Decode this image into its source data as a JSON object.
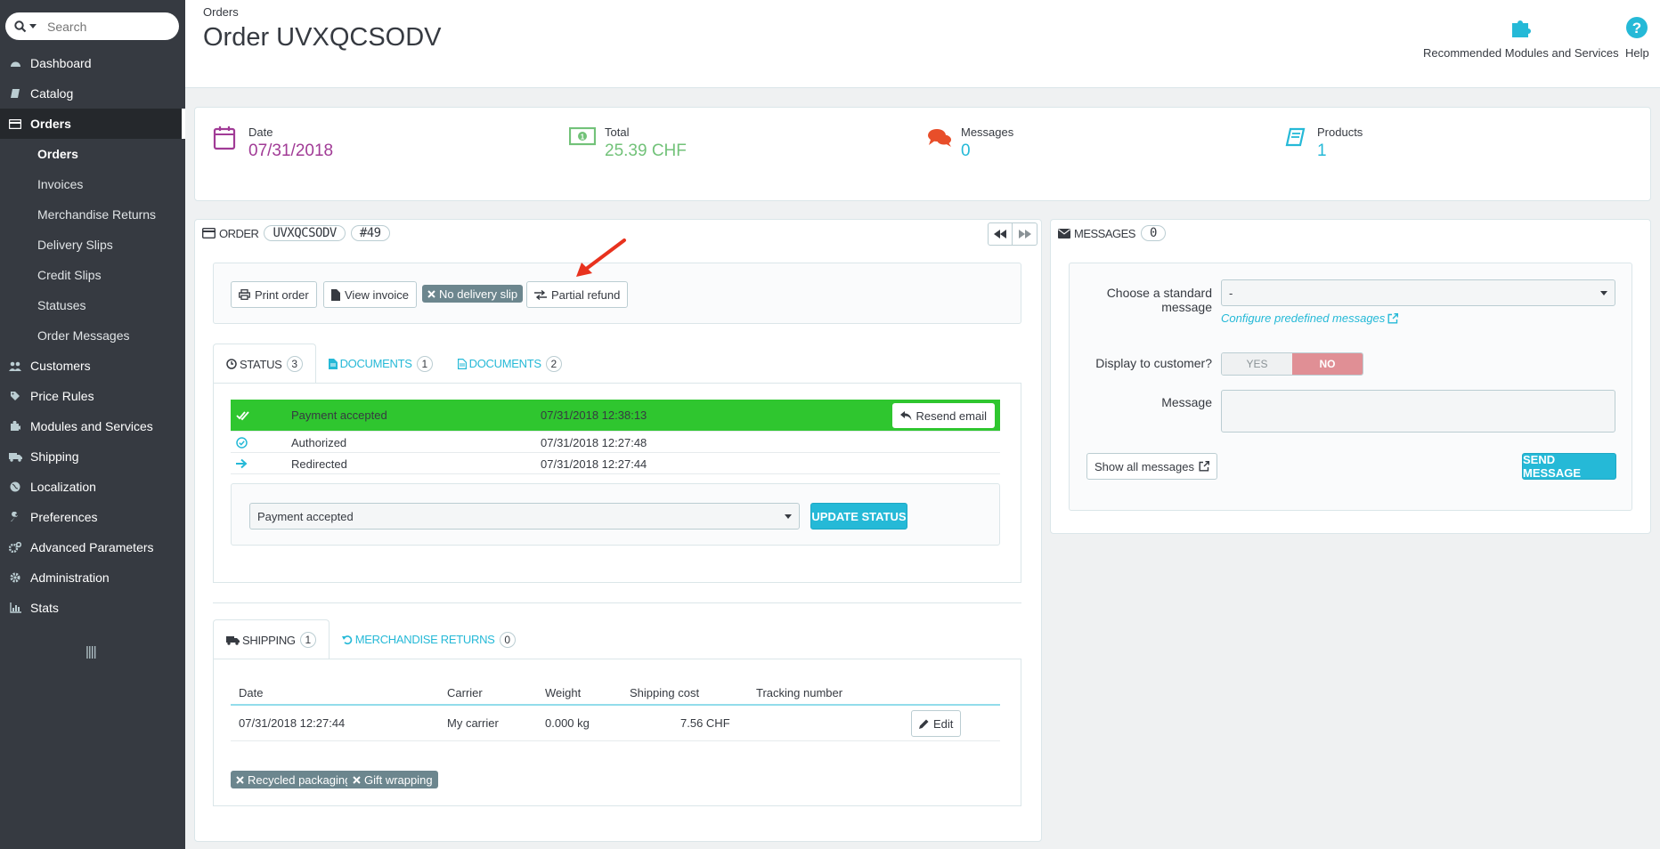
{
  "search": {
    "placeholder": "Search"
  },
  "menu": [
    {
      "name": "dashboard",
      "label": "Dashboard",
      "icon": "dashboard-icon"
    },
    {
      "name": "catalog",
      "label": "Catalog",
      "icon": "catalog-icon"
    },
    {
      "name": "orders",
      "label": "Orders",
      "icon": "orders-icon"
    },
    {
      "name": "customers",
      "label": "Customers",
      "icon": "customers-icon"
    },
    {
      "name": "price-rules",
      "label": "Price Rules",
      "icon": "tag-icon"
    },
    {
      "name": "modules",
      "label": "Modules and Services",
      "icon": "puzzle-icon"
    },
    {
      "name": "shipping",
      "label": "Shipping",
      "icon": "truck-icon"
    },
    {
      "name": "localization",
      "label": "Localization",
      "icon": "globe-icon"
    },
    {
      "name": "preferences",
      "label": "Preferences",
      "icon": "wrench-icon"
    },
    {
      "name": "advanced",
      "label": "Advanced Parameters",
      "icon": "cogs-icon"
    },
    {
      "name": "administration",
      "label": "Administration",
      "icon": "gear-icon"
    },
    {
      "name": "stats",
      "label": "Stats",
      "icon": "bar-chart-icon"
    }
  ],
  "submenu": [
    "Orders",
    "Invoices",
    "Merchandise Returns",
    "Delivery Slips",
    "Credit Slips",
    "Statuses",
    "Order Messages"
  ],
  "header": {
    "breadcrumb": "Orders",
    "title": "Order UVXQCSODV",
    "modules_label": "Recommended Modules and Services",
    "help_label": "Help"
  },
  "kpis": {
    "date_label": "Date",
    "date_value": "07/31/2018",
    "total_label": "Total",
    "total_value": "25.39 CHF",
    "messages_label": "Messages",
    "messages_value": "0",
    "products_label": "Products",
    "products_value": "1"
  },
  "order_panel": {
    "heading": "ORDER",
    "reference": "UVXQCSODV",
    "number": "#49",
    "print_label": "Print order",
    "invoice_label": "View invoice",
    "no_delivery_label": "No delivery slip",
    "partial_refund_label": "Partial refund"
  },
  "status_tabs": {
    "status_label": "STATUS",
    "status_count": "3",
    "docs1_label": "DOCUMENTS",
    "docs1_count": "1",
    "docs2_label": "DOCUMENTS",
    "docs2_count": "2"
  },
  "history": [
    {
      "status": "Payment accepted",
      "date": "07/31/2018 12:38:13"
    },
    {
      "status": "Authorized",
      "date": "07/31/2018 12:27:48"
    },
    {
      "status": "Redirected",
      "date": "07/31/2018 12:27:44"
    }
  ],
  "resend_label": "Resend email",
  "status_select_value": "Payment accepted",
  "update_status_label": "UPDATE STATUS",
  "shipping_tabs": {
    "shipping_label": "SHIPPING",
    "shipping_count": "1",
    "returns_label": "MERCHANDISE RETURNS",
    "returns_count": "0"
  },
  "shipping_table": {
    "headers": [
      "Date",
      "Carrier",
      "Weight",
      "Shipping cost",
      "Tracking number"
    ],
    "row": {
      "date": "07/31/2018 12:27:44",
      "carrier": "My carrier",
      "weight": "0.000 kg",
      "cost": "7.56 CHF"
    },
    "edit_label": "Edit"
  },
  "options": {
    "recycled": "Recycled packaging",
    "gift": "Gift wrapping"
  },
  "messages_panel": {
    "heading": "MESSAGES",
    "count": "0",
    "standard_label_1": "Choose a standard",
    "standard_label_2": "message",
    "standard_value": "-",
    "configure_link": "Configure predefined messages",
    "display_label": "Display to customer?",
    "yes_label": "YES",
    "no_label": "NO",
    "message_label": "Message",
    "show_all_label": "Show all messages",
    "send_label": "SEND MESSAGE"
  },
  "colors": {
    "accent": "#25b9d7",
    "date": "#a13b96",
    "total": "#72c279",
    "danger": "#e08f95",
    "success": "#2fc62f"
  }
}
